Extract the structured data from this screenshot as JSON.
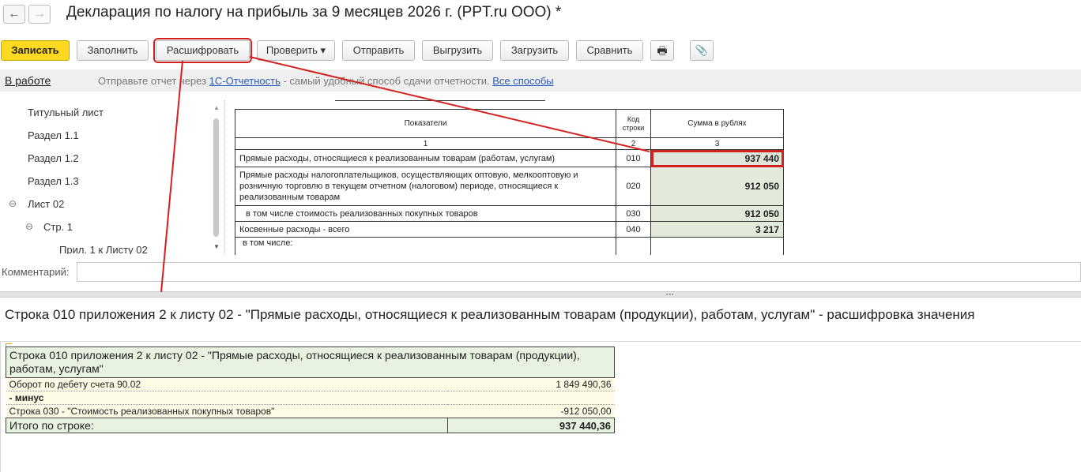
{
  "window": {
    "title": "Декларация по налогу на прибыль за 9 месяцев 2026 г. (PPT.ru ООО) *",
    "back_icon": "←",
    "forward_icon": "→"
  },
  "toolbar": {
    "save": "Записать",
    "fill": "Заполнить",
    "decode": "Расшифровать",
    "check": "Проверить ▾",
    "send": "Отправить",
    "export": "Выгрузить",
    "import": "Загрузить",
    "compare": "Сравнить",
    "print_icon": "🖶",
    "attach_icon": "📎"
  },
  "status": {
    "state": "В работе",
    "message_prefix": "Отправьте отчет через ",
    "service_link": "1С-Отчетность",
    "message_suffix": " - самый удобный способ сдачи отчетности. ",
    "all_methods_link": "Все способы"
  },
  "tree": {
    "items": [
      {
        "label": "Титульный лист",
        "toggle": ""
      },
      {
        "label": "Раздел 1.1",
        "toggle": ""
      },
      {
        "label": "Раздел 1.2",
        "toggle": ""
      },
      {
        "label": "Раздел 1.3",
        "toggle": ""
      },
      {
        "label": "Лист 02",
        "toggle": "⊖"
      },
      {
        "label": "Стр. 1",
        "toggle": "⊖"
      },
      {
        "label": "Прил. 1 к Листу 02",
        "toggle": ""
      }
    ]
  },
  "form_table": {
    "header": {
      "indicators": "Показатели",
      "code": "Код строки",
      "amount": "Сумма в рублях"
    },
    "col_numbers": [
      "1",
      "2",
      "3"
    ],
    "rows": [
      {
        "label": "Прямые расходы, относящиеся к реализованным товарам (работам, услугам)",
        "code": "010",
        "value": "937 440"
      },
      {
        "label": "Прямые расходы налогоплательщиков, осуществляющих оптовую, мелкооптовую и розничную торговлю в текущем отчетном (налоговом) периоде, относящиеся к реализованным товарам",
        "code": "020",
        "value": "912 050"
      },
      {
        "label": "в том числе стоимость реализованных покупных товаров",
        "code": "030",
        "value": "912 050"
      },
      {
        "label": "Косвенные расходы - всего",
        "code": "040",
        "value": "3 217"
      },
      {
        "label": "в том числе:",
        "code": "",
        "value": ""
      }
    ]
  },
  "comment": {
    "label": "Комментарий:",
    "value": ""
  },
  "detail": {
    "title": "Строка 010 приложения 2 к листу 02 - \"Прямые расходы, относящиеся к реализованным товарам (продукции), работам, услугам\" - расшифровка значения",
    "table": {
      "header": "Строка 010 приложения 2 к листу 02 - \"Прямые расходы, относящиеся к реализованным товарам (продукции), работам, услугам\"",
      "rows": [
        {
          "label": "Оборот по дебету счета 90.02",
          "amount": "1 849 490,36"
        },
        {
          "label": "- минус",
          "amount": ""
        },
        {
          "label": "Строка 030 - \"Стоимость реализованных покупных товаров\"",
          "amount": "-912 050,00"
        }
      ],
      "total_label": "Итого по строке:",
      "total_amount": "937 440,36"
    }
  },
  "colors": {
    "primary_button": "#ffd91f",
    "highlight_red": "#d32020",
    "cell_green": "#e1eadb",
    "link_blue": "#2a5bb8"
  }
}
